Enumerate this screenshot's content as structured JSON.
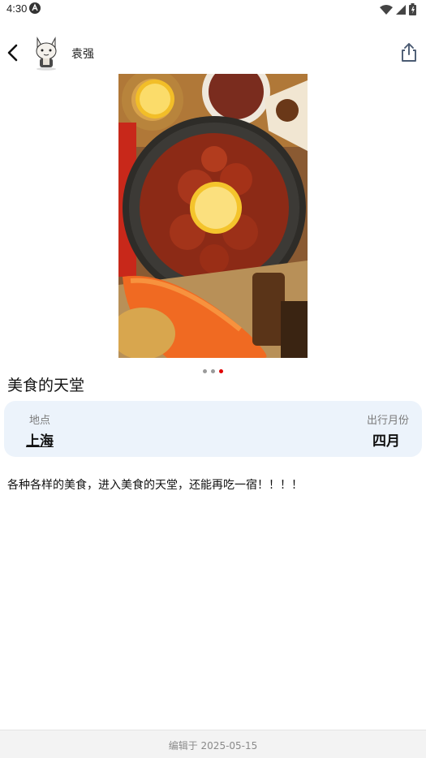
{
  "status": {
    "time": "4:30"
  },
  "header": {
    "author_name": "袁强"
  },
  "carousel": {
    "total": 3,
    "active_index": 2
  },
  "post": {
    "title": "美食的天堂",
    "location_label": "地点",
    "location_value": "上海",
    "month_label": "出行月份",
    "month_value": "四月",
    "description": "各种各样的美食，进入美食的天堂，还能再吃一宿！！！！"
  },
  "footer": {
    "edited_text": "编辑于 2025-05-15"
  },
  "icons": {
    "back": "back-arrow-icon",
    "share": "share-icon",
    "wifi": "wifi-icon",
    "signal": "signal-icon",
    "battery": "battery-icon"
  },
  "colors": {
    "card_bg": "#ecf3fb",
    "active_dot": "#e00000"
  }
}
